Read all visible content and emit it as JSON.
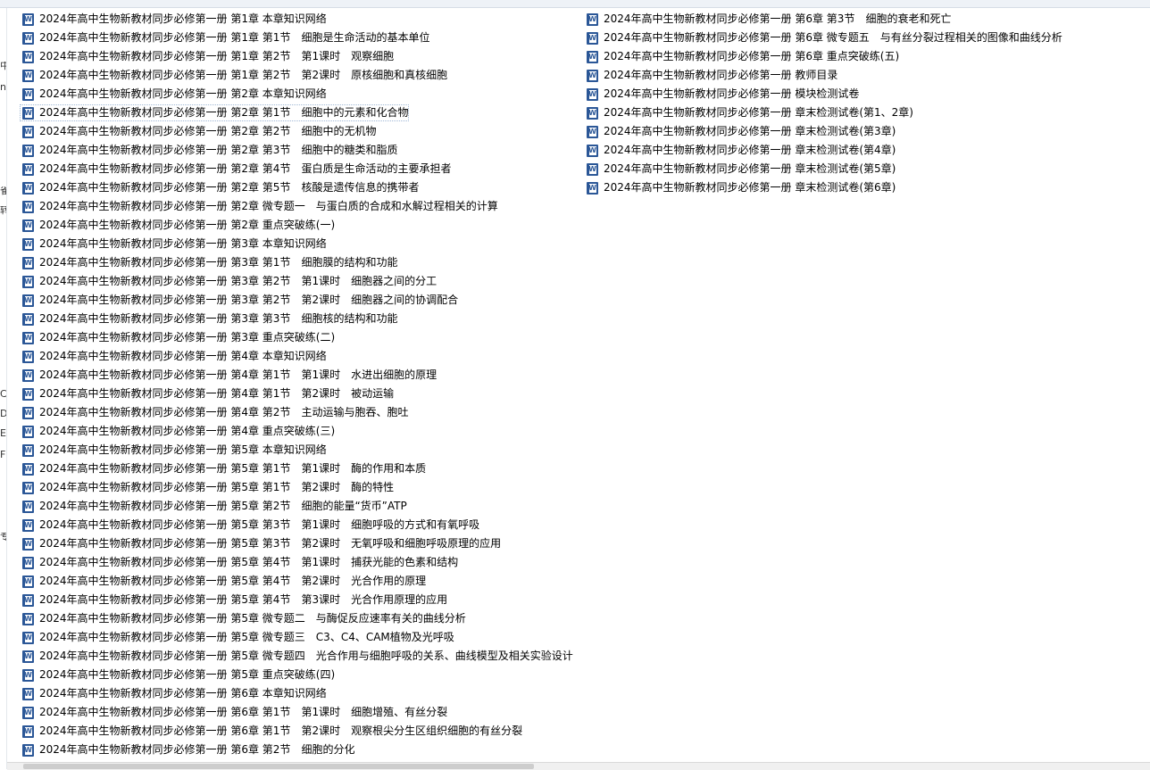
{
  "files": {
    "column1": [
      "2024年高中生物新教材同步必修第一册 第1章 本章知识网络",
      "2024年高中生物新教材同步必修第一册 第1章 第1节　细胞是生命活动的基本单位",
      "2024年高中生物新教材同步必修第一册 第1章 第2节　第1课时　观察细胞",
      "2024年高中生物新教材同步必修第一册 第1章 第2节　第2课时　原核细胞和真核细胞",
      "2024年高中生物新教材同步必修第一册 第2章 本章知识网络",
      "2024年高中生物新教材同步必修第一册 第2章 第1节　细胞中的元素和化合物",
      "2024年高中生物新教材同步必修第一册 第2章 第2节　细胞中的无机物",
      "2024年高中生物新教材同步必修第一册 第2章 第3节　细胞中的糖类和脂质",
      "2024年高中生物新教材同步必修第一册 第2章 第4节　蛋白质是生命活动的主要承担者",
      "2024年高中生物新教材同步必修第一册 第2章 第5节　核酸是遗传信息的携带者",
      "2024年高中生物新教材同步必修第一册 第2章 微专题一　与蛋白质的合成和水解过程相关的计算",
      "2024年高中生物新教材同步必修第一册 第2章 重点突破练(一)",
      "2024年高中生物新教材同步必修第一册 第3章 本章知识网络",
      "2024年高中生物新教材同步必修第一册 第3章 第1节　细胞膜的结构和功能",
      "2024年高中生物新教材同步必修第一册 第3章 第2节　第1课时　细胞器之间的分工",
      "2024年高中生物新教材同步必修第一册 第3章 第2节　第2课时　细胞器之间的协调配合",
      "2024年高中生物新教材同步必修第一册 第3章 第3节　细胞核的结构和功能",
      "2024年高中生物新教材同步必修第一册 第3章 重点突破练(二)",
      "2024年高中生物新教材同步必修第一册 第4章 本章知识网络",
      "2024年高中生物新教材同步必修第一册 第4章 第1节　第1课时　水进出细胞的原理",
      "2024年高中生物新教材同步必修第一册 第4章 第1节　第2课时　被动运输",
      "2024年高中生物新教材同步必修第一册 第4章 第2节　主动运输与胞吞、胞吐",
      "2024年高中生物新教材同步必修第一册 第4章 重点突破练(三)",
      "2024年高中生物新教材同步必修第一册 第5章 本章知识网络",
      "2024年高中生物新教材同步必修第一册 第5章 第1节　第1课时　酶的作用和本质",
      "2024年高中生物新教材同步必修第一册 第5章 第1节　第2课时　酶的特性",
      "2024年高中生物新教材同步必修第一册 第5章 第2节　细胞的能量“货币”ATP",
      "2024年高中生物新教材同步必修第一册 第5章 第3节　第1课时　细胞呼吸的方式和有氧呼吸",
      "2024年高中生物新教材同步必修第一册 第5章 第3节　第2课时　无氧呼吸和细胞呼吸原理的应用",
      "2024年高中生物新教材同步必修第一册 第5章 第4节　第1课时　捕获光能的色素和结构",
      "2024年高中生物新教材同步必修第一册 第5章 第4节　第2课时　光合作用的原理",
      "2024年高中生物新教材同步必修第一册 第5章 第4节　第3课时　光合作用原理的应用",
      "2024年高中生物新教材同步必修第一册 第5章 微专题二　与酶促反应速率有关的曲线分析",
      "2024年高中生物新教材同步必修第一册 第5章 微专题三　C3、C4、CAM植物及光呼吸",
      "2024年高中生物新教材同步必修第一册 第5章 微专题四　光合作用与细胞呼吸的关系、曲线模型及相关实验设计",
      "2024年高中生物新教材同步必修第一册 第5章 重点突破练(四)",
      "2024年高中生物新教材同步必修第一册 第6章 本章知识网络",
      "2024年高中生物新教材同步必修第一册 第6章 第1节　第1课时　细胞增殖、有丝分裂",
      "2024年高中生物新教材同步必修第一册 第6章 第1节　第2课时　观察根尖分生区组织细胞的有丝分裂",
      "2024年高中生物新教材同步必修第一册 第6章 第2节　细胞的分化"
    ],
    "column2": [
      "2024年高中生物新教材同步必修第一册 第6章 第3节　细胞的衰老和死亡",
      "2024年高中生物新教材同步必修第一册 第6章 微专题五　与有丝分裂过程相关的图像和曲线分析",
      "2024年高中生物新教材同步必修第一册 第6章 重点突破练(五)",
      "2024年高中生物新教材同步必修第一册 教师目录",
      "2024年高中生物新教材同步必修第一册 模块检测试卷",
      "2024年高中生物新教材同步必修第一册 章末检测试卷(第1、2章)",
      "2024年高中生物新教材同步必修第一册 章末检测试卷(第3章)",
      "2024年高中生物新教材同步必修第一册 章末检测试卷(第4章)",
      "2024年高中生物新教材同步必修第一册 章末检测试卷(第5章)",
      "2024年高中生物新教材同步必修第一册 章末检测试卷(第6章)"
    ],
    "focused_index": 5,
    "icon": "word-document-icon",
    "icon_color": "#2b5797"
  },
  "left_pane": {
    "fragments": [
      "中",
      "n",
      "雀",
      "转",
      "C",
      "D",
      "E",
      "F",
      "专"
    ]
  }
}
